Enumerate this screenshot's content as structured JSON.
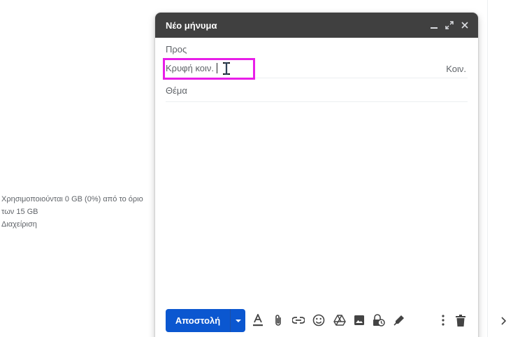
{
  "storage": {
    "usage_line1": "Χρησιμοποιούνται 0 GB (0%) από το όριο",
    "usage_line2": "των 15 GB",
    "manage_link": "Διαχείριση"
  },
  "compose": {
    "title": "Νέο μήνυμα",
    "to_label": "Προς",
    "bcc_label": "Κρυφή κοιν.",
    "cc_link": "Κοιν.",
    "subject_placeholder": "Θέμα",
    "send_label": "Αποστολή",
    "highlight_color": "#e81ee8",
    "send_color": "#0b57d0"
  },
  "icons": [
    "minimize-icon",
    "expand-icon",
    "close-icon",
    "send-options-icon",
    "text-format-icon",
    "attach-icon",
    "link-icon",
    "emoji-icon",
    "drive-icon",
    "photo-icon",
    "confidential-icon",
    "signature-icon",
    "more-options-icon",
    "trash-icon",
    "chevron-right-icon"
  ]
}
